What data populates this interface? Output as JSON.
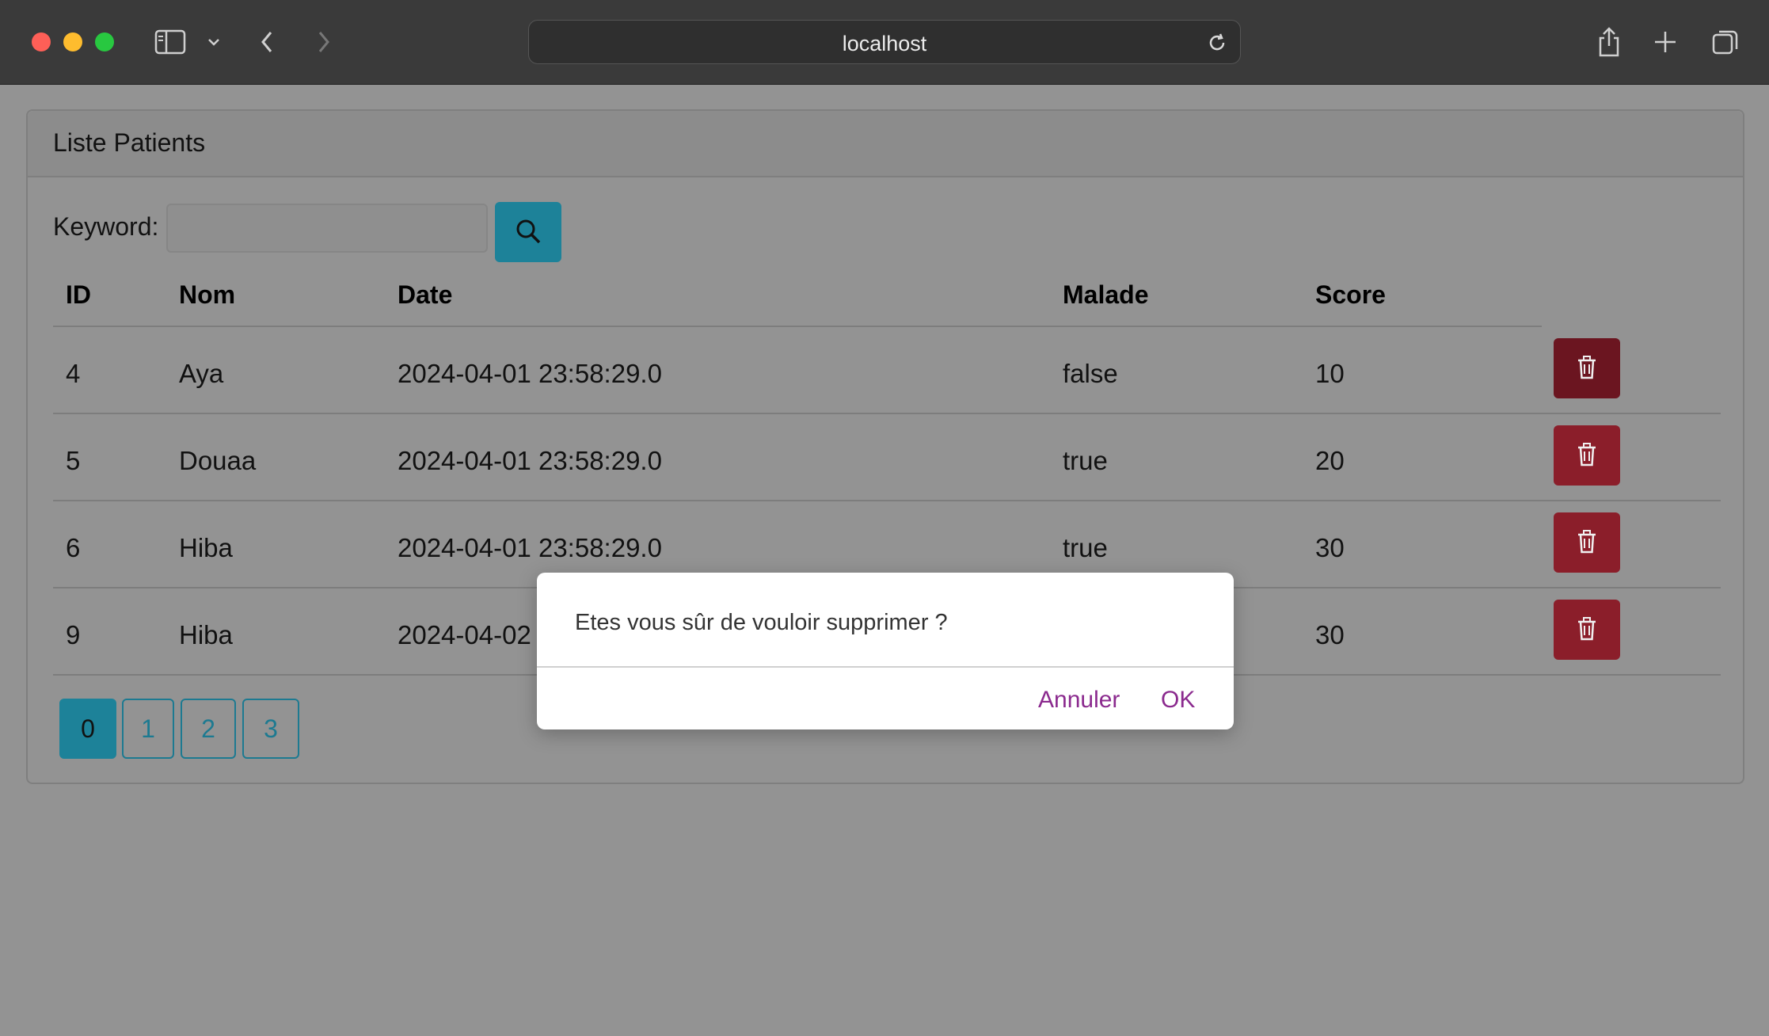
{
  "browser": {
    "url": "localhost"
  },
  "card": {
    "title": "Liste Patients"
  },
  "search": {
    "label": "Keyword:",
    "value": "",
    "placeholder": ""
  },
  "table": {
    "headers": [
      "ID",
      "Nom",
      "Date",
      "Malade",
      "Score"
    ],
    "rows": [
      {
        "id": "4",
        "nom": "Aya",
        "date": "2024-04-01 23:58:29.0",
        "malade": "false",
        "score": "10"
      },
      {
        "id": "5",
        "nom": "Douaa",
        "date": "2024-04-01 23:58:29.0",
        "malade": "true",
        "score": "20"
      },
      {
        "id": "6",
        "nom": "Hiba",
        "date": "2024-04-01 23:58:29.0",
        "malade": "true",
        "score": "30"
      },
      {
        "id": "9",
        "nom": "Hiba",
        "date": "2024-04-02",
        "malade": "",
        "score": "30"
      }
    ]
  },
  "pagination": {
    "pages": [
      "0",
      "1",
      "2",
      "3"
    ],
    "current": "0"
  },
  "dialog": {
    "message": "Etes vous sûr de vouloir supprimer ?",
    "cancel_label": "Annuler",
    "ok_label": "OK"
  },
  "colors": {
    "primary": "#1d8299",
    "danger": "#8b1e2a",
    "dialog_button": "#8b2a8e"
  },
  "icons": {
    "search": "search-icon",
    "delete": "trash-icon"
  }
}
